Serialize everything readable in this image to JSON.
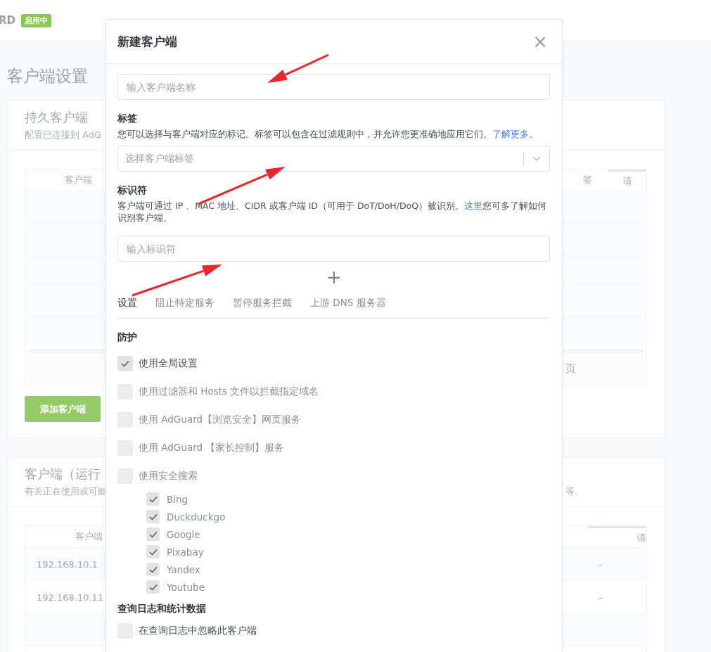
{
  "header": {
    "logo": "RD",
    "status_badge": "启用中"
  },
  "page": {
    "title": "客户端设置"
  },
  "persistent_clients": {
    "title": "持久客户端",
    "subtitle": "配置已连接到 AdG",
    "columns": [
      "客户端",
      "签",
      "请"
    ],
    "pagination": [
      "页"
    ],
    "add_button": "添加客户端"
  },
  "runtime_clients": {
    "title": "客户端（运行",
    "subtitle_start": "有关正在使用或可能",
    "subtitle_end": "等。",
    "columns": [
      "客户端",
      "请"
    ],
    "rows": [
      {
        "client": "192.168.10.1",
        "column_2": "–"
      },
      {
        "client": "192.168.10.11",
        "column_2": "–"
      }
    ]
  },
  "dialog": {
    "title": "新建客户端",
    "close": "×",
    "name_field": {
      "placeholder": "输入客户端名称"
    },
    "tags": {
      "label": "标签",
      "description": "您可以选择与客户端对应的标记。标签可以包含在过滤规则中，并允许您更准确地应用它们。",
      "link": "了解更多",
      "description_end": "。",
      "placeholder": "选择客户端标签"
    },
    "identifiers": {
      "label": "标识符",
      "description": "客户端可通过 IP 、MAC 地址、CIDR 或客户端 ID（可用于 DoT/DoH/DoQ）被识别。",
      "link": "这里",
      "description_end": "您可多了解如何识别客户端。",
      "placeholder": "输入标识符",
      "add_button": "+"
    },
    "tabs": [
      {
        "label": "设置",
        "selected": true
      },
      {
        "label": "阻止特定服务",
        "selected": false
      },
      {
        "label": "暂停服务拦截",
        "selected": false
      },
      {
        "label": "上游 DNS 服务器",
        "selected": false
      }
    ],
    "protection": {
      "title": "防护",
      "options": [
        {
          "label": "使用全局设置",
          "checked": true,
          "disabled": false
        },
        {
          "label": "使用过滤器和 Hosts 文件以拦截指定域名",
          "checked": false,
          "disabled": true
        },
        {
          "label": "使用 AdGuard【浏览安全】网页服务",
          "checked": false,
          "disabled": true
        },
        {
          "label": "使用 AdGuard 【家长控制】服务",
          "checked": false,
          "disabled": true
        },
        {
          "label": "使用安全搜索",
          "checked": false,
          "disabled": true,
          "children": [
            {
              "label": "Bing",
              "checked": true,
              "disabled": true
            },
            {
              "label": "Duckduckgo",
              "checked": true,
              "disabled": true
            },
            {
              "label": "Google",
              "checked": true,
              "disabled": true
            },
            {
              "label": "Pixabay",
              "checked": true,
              "disabled": true
            },
            {
              "label": "Yandex",
              "checked": true,
              "disabled": true
            },
            {
              "label": "Youtube",
              "checked": true,
              "disabled": true
            }
          ]
        }
      ]
    },
    "logs": {
      "title": "查询日志和统计数据",
      "options": [
        {
          "label": "在查询日志中忽略此客户端",
          "checked": false,
          "disabled": false
        }
      ]
    }
  }
}
